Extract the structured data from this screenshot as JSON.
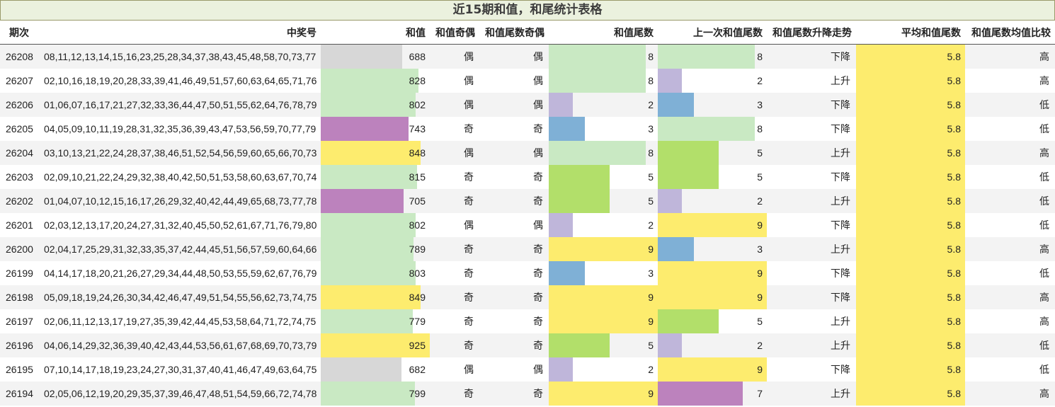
{
  "title": "近15期和值，和尾统计表格",
  "headers": [
    "期次",
    "中奖号",
    "和值",
    "和值奇偶",
    "和值尾数奇偶",
    "和值尾数",
    "上一次和值尾数",
    "和值尾数升降走势",
    "平均和值尾数",
    "和值尾数均值比较"
  ],
  "colors": {
    "gray": "#d7d7d7",
    "lightgreen": "#c9e9c3",
    "purple": "#bc82bd",
    "yellow": "#fdec6e",
    "blue": "#7fb0d6",
    "lavender": "#bfb6da",
    "green": "#b2df6a"
  },
  "scale": {
    "sum_max": 925,
    "tail_max": 9
  },
  "rows": [
    {
      "period": "26208",
      "numbers": "08,11,12,13,14,15,16,23,25,28,34,37,38,43,45,48,58,70,73,77",
      "sum": "688",
      "sum_value": 688,
      "sum_color": "gray",
      "sum_parity": "偶",
      "tail_parity": "偶",
      "tail": "8",
      "tail_value": 8,
      "tail_color": "lightgreen",
      "prev_tail": "8",
      "prev_value": 8,
      "prev_color": "lightgreen",
      "trend": "下降",
      "avg": "5.8",
      "compare": "高"
    },
    {
      "period": "26207",
      "numbers": "02,10,16,18,19,20,28,33,39,41,46,49,51,57,60,63,64,65,71,76",
      "sum": "828",
      "sum_value": 828,
      "sum_color": "lightgreen",
      "sum_parity": "偶",
      "tail_parity": "偶",
      "tail": "8",
      "tail_value": 8,
      "tail_color": "lightgreen",
      "prev_tail": "2",
      "prev_value": 2,
      "prev_color": "lavender",
      "trend": "上升",
      "avg": "5.8",
      "compare": "高"
    },
    {
      "period": "26206",
      "numbers": "01,06,07,16,17,21,27,32,33,36,44,47,50,51,55,62,64,76,78,79",
      "sum": "802",
      "sum_value": 802,
      "sum_color": "lightgreen",
      "sum_parity": "偶",
      "tail_parity": "偶",
      "tail": "2",
      "tail_value": 2,
      "tail_color": "lavender",
      "prev_tail": "3",
      "prev_value": 3,
      "prev_color": "blue",
      "trend": "下降",
      "avg": "5.8",
      "compare": "低"
    },
    {
      "period": "26205",
      "numbers": "04,05,09,10,11,19,28,31,32,35,36,39,43,47,53,56,59,70,77,79",
      "sum": "743",
      "sum_value": 743,
      "sum_color": "purple",
      "sum_parity": "奇",
      "tail_parity": "奇",
      "tail": "3",
      "tail_value": 3,
      "tail_color": "blue",
      "prev_tail": "8",
      "prev_value": 8,
      "prev_color": "lightgreen",
      "trend": "下降",
      "avg": "5.8",
      "compare": "低"
    },
    {
      "period": "26204",
      "numbers": "03,10,13,21,22,24,28,37,38,46,51,52,54,56,59,60,65,66,70,73",
      "sum": "848",
      "sum_value": 848,
      "sum_color": "yellow",
      "sum_parity": "偶",
      "tail_parity": "偶",
      "tail": "8",
      "tail_value": 8,
      "tail_color": "lightgreen",
      "prev_tail": "5",
      "prev_value": 5,
      "prev_color": "green",
      "trend": "上升",
      "avg": "5.8",
      "compare": "高"
    },
    {
      "period": "26203",
      "numbers": "02,09,10,21,22,24,29,32,38,40,42,50,51,53,58,60,63,67,70,74",
      "sum": "815",
      "sum_value": 815,
      "sum_color": "lightgreen",
      "sum_parity": "奇",
      "tail_parity": "奇",
      "tail": "5",
      "tail_value": 5,
      "tail_color": "green",
      "prev_tail": "5",
      "prev_value": 5,
      "prev_color": "green",
      "trend": "下降",
      "avg": "5.8",
      "compare": "低"
    },
    {
      "period": "26202",
      "numbers": "01,04,07,10,12,15,16,17,26,29,32,40,42,44,49,65,68,73,77,78",
      "sum": "705",
      "sum_value": 705,
      "sum_color": "purple",
      "sum_parity": "奇",
      "tail_parity": "奇",
      "tail": "5",
      "tail_value": 5,
      "tail_color": "green",
      "prev_tail": "2",
      "prev_value": 2,
      "prev_color": "lavender",
      "trend": "上升",
      "avg": "5.8",
      "compare": "低"
    },
    {
      "period": "26201",
      "numbers": "02,03,12,13,17,20,24,27,31,32,40,45,50,52,61,67,71,76,79,80",
      "sum": "802",
      "sum_value": 802,
      "sum_color": "lightgreen",
      "sum_parity": "偶",
      "tail_parity": "偶",
      "tail": "2",
      "tail_value": 2,
      "tail_color": "lavender",
      "prev_tail": "9",
      "prev_value": 9,
      "prev_color": "yellow",
      "trend": "下降",
      "avg": "5.8",
      "compare": "低"
    },
    {
      "period": "26200",
      "numbers": "02,04,17,25,29,31,32,33,35,37,42,44,45,51,56,57,59,60,64,66",
      "sum": "789",
      "sum_value": 789,
      "sum_color": "lightgreen",
      "sum_parity": "奇",
      "tail_parity": "奇",
      "tail": "9",
      "tail_value": 9,
      "tail_color": "yellow",
      "prev_tail": "3",
      "prev_value": 3,
      "prev_color": "blue",
      "trend": "上升",
      "avg": "5.8",
      "compare": "高"
    },
    {
      "period": "26199",
      "numbers": "04,14,17,18,20,21,26,27,29,34,44,48,50,53,55,59,62,67,76,79",
      "sum": "803",
      "sum_value": 803,
      "sum_color": "lightgreen",
      "sum_parity": "奇",
      "tail_parity": "奇",
      "tail": "3",
      "tail_value": 3,
      "tail_color": "blue",
      "prev_tail": "9",
      "prev_value": 9,
      "prev_color": "yellow",
      "trend": "下降",
      "avg": "5.8",
      "compare": "低"
    },
    {
      "period": "26198",
      "numbers": "05,09,18,19,24,26,30,34,42,46,47,49,51,54,55,56,62,73,74,75",
      "sum": "849",
      "sum_value": 849,
      "sum_color": "yellow",
      "sum_parity": "奇",
      "tail_parity": "奇",
      "tail": "9",
      "tail_value": 9,
      "tail_color": "yellow",
      "prev_tail": "9",
      "prev_value": 9,
      "prev_color": "yellow",
      "trend": "下降",
      "avg": "5.8",
      "compare": "高"
    },
    {
      "period": "26197",
      "numbers": "02,06,11,12,13,17,19,27,35,39,42,44,45,53,58,64,71,72,74,75",
      "sum": "779",
      "sum_value": 779,
      "sum_color": "lightgreen",
      "sum_parity": "奇",
      "tail_parity": "奇",
      "tail": "9",
      "tail_value": 9,
      "tail_color": "yellow",
      "prev_tail": "5",
      "prev_value": 5,
      "prev_color": "green",
      "trend": "上升",
      "avg": "5.8",
      "compare": "高"
    },
    {
      "period": "26196",
      "numbers": "04,06,14,29,32,36,39,40,42,43,44,53,56,61,67,68,69,70,73,79",
      "sum": "925",
      "sum_value": 925,
      "sum_color": "yellow",
      "sum_parity": "奇",
      "tail_parity": "奇",
      "tail": "5",
      "tail_value": 5,
      "tail_color": "green",
      "prev_tail": "2",
      "prev_value": 2,
      "prev_color": "lavender",
      "trend": "上升",
      "avg": "5.8",
      "compare": "低"
    },
    {
      "period": "26195",
      "numbers": "07,10,14,17,18,19,23,24,27,30,31,37,40,41,46,47,49,63,64,75",
      "sum": "682",
      "sum_value": 682,
      "sum_color": "gray",
      "sum_parity": "偶",
      "tail_parity": "偶",
      "tail": "2",
      "tail_value": 2,
      "tail_color": "lavender",
      "prev_tail": "9",
      "prev_value": 9,
      "prev_color": "yellow",
      "trend": "下降",
      "avg": "5.8",
      "compare": "低"
    },
    {
      "period": "26194",
      "numbers": "02,05,06,12,19,20,29,35,37,39,46,47,48,51,54,59,66,72,74,78",
      "sum": "799",
      "sum_value": 799,
      "sum_color": "lightgreen",
      "sum_parity": "奇",
      "tail_parity": "奇",
      "tail": "9",
      "tail_value": 9,
      "tail_color": "yellow",
      "prev_tail": "7",
      "prev_value": 7,
      "prev_color": "purple",
      "trend": "上升",
      "avg": "5.8",
      "compare": "高"
    }
  ]
}
